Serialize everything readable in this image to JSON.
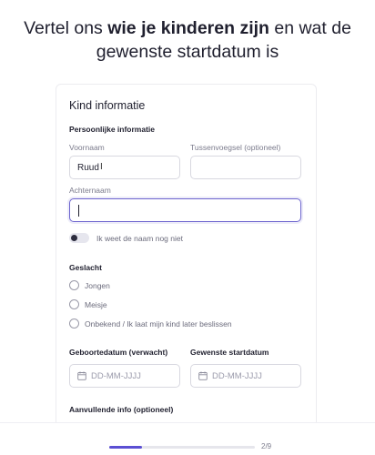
{
  "headline": {
    "part1": "Vertel ons ",
    "bold": "wie je kinderen zijn",
    "part2": " en wat de gewenste startdatum is"
  },
  "card": {
    "title": "Kind informatie",
    "personal_section": "Persoonlijke informatie",
    "first_name": {
      "label": "Voornaam",
      "value": "Ruud"
    },
    "infix": {
      "label": "Tussenvoegsel (optioneel)",
      "value": ""
    },
    "last_name": {
      "label": "Achternaam",
      "value": ""
    },
    "toggle_label": "Ik weet de naam nog niet",
    "gender": {
      "label": "Geslacht",
      "options": [
        "Jongen",
        "Meisje",
        "Onbekend / Ik laat mijn kind later beslissen"
      ]
    },
    "birthdate": {
      "label": "Geboortedatum (verwacht)",
      "placeholder": "DD-MM-JJJJ"
    },
    "startdate": {
      "label": "Gewenste startdatum",
      "placeholder": "DD-MM-JJJJ"
    },
    "extra_info_label": "Aanvullende info (optioneel)"
  },
  "progress": {
    "text": "2/9",
    "fraction": 0.222
  },
  "colors": {
    "accent": "#5b4fd3",
    "focus": "#6e66cf"
  },
  "icons": {
    "date": "calendar-icon",
    "toggle": "toggle-switch"
  }
}
